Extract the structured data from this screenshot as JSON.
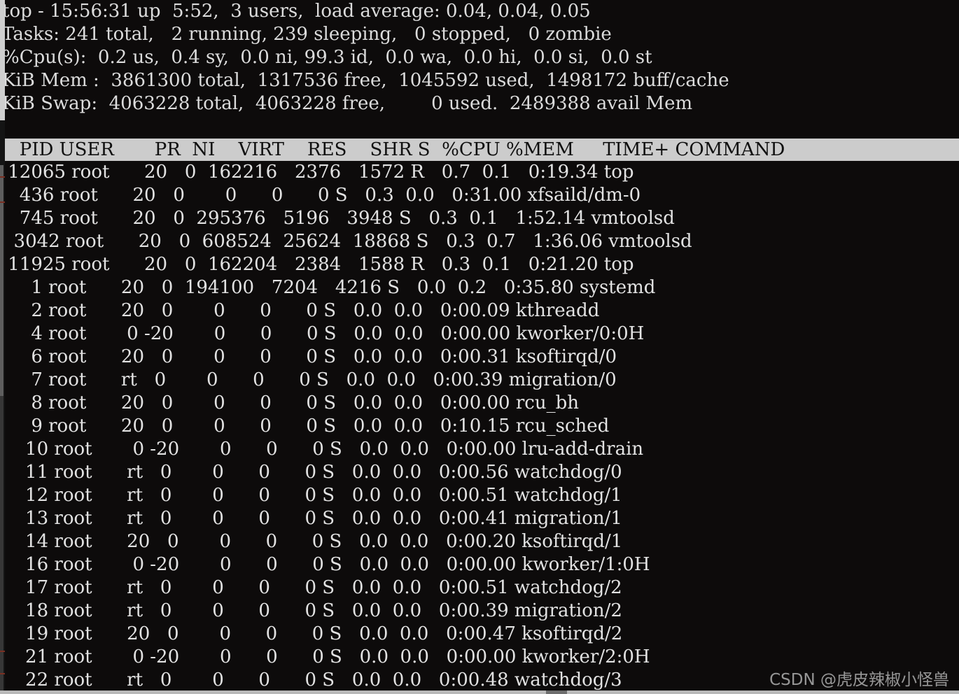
{
  "app": {
    "name": "top",
    "type": "terminal-process-monitor"
  },
  "summary": {
    "uptime_line": "top - 15:56:31 up  5:52,  3 users,  load average: 0.04, 0.04, 0.05",
    "tasks_line": "Tasks: 241 total,   2 running, 239 sleeping,   0 stopped,   0 zombie",
    "cpu_line": "%Cpu(s):  0.2 us,  0.4 sy,  0.0 ni, 99.3 id,  0.0 wa,  0.0 hi,  0.0 si,  0.0 st",
    "mem_line": "KiB Mem :  3861300 total,  1317536 free,  1045592 used,  1498172 buff/cache",
    "swap_line": "KiB Swap:  4063228 total,  4063228 free,        0 used.  2489388 avail Mem",
    "fields": {
      "time": "15:56:31",
      "up": "5:52",
      "users": "3",
      "load_avg_1": "0.04",
      "load_avg_5": "0.04",
      "load_avg_15": "0.05",
      "tasks_total": "241",
      "tasks_running": "2",
      "tasks_sleeping": "239",
      "tasks_stopped": "0",
      "tasks_zombie": "0",
      "cpu_us": "0.2",
      "cpu_sy": "0.4",
      "cpu_ni": "0.0",
      "cpu_id": "99.3",
      "cpu_wa": "0.0",
      "cpu_hi": "0.0",
      "cpu_si": "0.0",
      "cpu_st": "0.0",
      "mem_total": "3861300",
      "mem_free": "1317536",
      "mem_used": "1045592",
      "mem_buff_cache": "1498172",
      "swap_total": "4063228",
      "swap_free": "4063228",
      "swap_used": "0",
      "avail_mem": "2489388"
    }
  },
  "table": {
    "header_line": "   PID USER       PR  NI    VIRT    RES    SHR S  %CPU %MEM     TIME+ COMMAND",
    "columns": [
      "PID",
      "USER",
      "PR",
      "NI",
      "VIRT",
      "RES",
      "SHR",
      "S",
      "%CPU",
      "%MEM",
      "TIME+",
      "COMMAND"
    ],
    "rows": [
      {
        "line": " 12065 root      20   0  162216   2376   1572 R   0.7  0.1   0:19.34 top",
        "pid": "12065",
        "user": "root",
        "pr": "20",
        "ni": "0",
        "virt": "162216",
        "res": "2376",
        "shr": "1572",
        "s": "R",
        "cpu": "0.7",
        "mem": "0.1",
        "time": "0:19.34",
        "command": "top"
      },
      {
        "line": "   436 root      20   0       0      0      0 S   0.3  0.0   0:31.00 xfsaild/dm-0",
        "pid": "436",
        "user": "root",
        "pr": "20",
        "ni": "0",
        "virt": "0",
        "res": "0",
        "shr": "0",
        "s": "S",
        "cpu": "0.3",
        "mem": "0.0",
        "time": "0:31.00",
        "command": "xfsaild/dm-0"
      },
      {
        "line": "   745 root      20   0  295376   5196   3948 S   0.3  0.1   1:52.14 vmtoolsd",
        "pid": "745",
        "user": "root",
        "pr": "20",
        "ni": "0",
        "virt": "295376",
        "res": "5196",
        "shr": "3948",
        "s": "S",
        "cpu": "0.3",
        "mem": "0.1",
        "time": "1:52.14",
        "command": "vmtoolsd"
      },
      {
        "line": "  3042 root      20   0  608524  25624  18868 S   0.3  0.7   1:36.06 vmtoolsd",
        "pid": "3042",
        "user": "root",
        "pr": "20",
        "ni": "0",
        "virt": "608524",
        "res": "25624",
        "shr": "18868",
        "s": "S",
        "cpu": "0.3",
        "mem": "0.7",
        "time": "1:36.06",
        "command": "vmtoolsd"
      },
      {
        "line": " 11925 root      20   0  162204   2384   1588 R   0.3  0.1   0:21.20 top",
        "pid": "11925",
        "user": "root",
        "pr": "20",
        "ni": "0",
        "virt": "162204",
        "res": "2384",
        "shr": "1588",
        "s": "R",
        "cpu": "0.3",
        "mem": "0.1",
        "time": "0:21.20",
        "command": "top"
      },
      {
        "line": "     1 root      20   0  194100   7204   4216 S   0.0  0.2   0:35.80 systemd",
        "pid": "1",
        "user": "root",
        "pr": "20",
        "ni": "0",
        "virt": "194100",
        "res": "7204",
        "shr": "4216",
        "s": "S",
        "cpu": "0.0",
        "mem": "0.2",
        "time": "0:35.80",
        "command": "systemd"
      },
      {
        "line": "     2 root      20   0       0      0      0 S   0.0  0.0   0:00.09 kthreadd",
        "pid": "2",
        "user": "root",
        "pr": "20",
        "ni": "0",
        "virt": "0",
        "res": "0",
        "shr": "0",
        "s": "S",
        "cpu": "0.0",
        "mem": "0.0",
        "time": "0:00.09",
        "command": "kthreadd"
      },
      {
        "line": "     4 root       0 -20       0      0      0 S   0.0  0.0   0:00.00 kworker/0:0H",
        "pid": "4",
        "user": "root",
        "pr": "0",
        "ni": "-20",
        "virt": "0",
        "res": "0",
        "shr": "0",
        "s": "S",
        "cpu": "0.0",
        "mem": "0.0",
        "time": "0:00.00",
        "command": "kworker/0:0H"
      },
      {
        "line": "     6 root      20   0       0      0      0 S   0.0  0.0   0:00.31 ksoftirqd/0",
        "pid": "6",
        "user": "root",
        "pr": "20",
        "ni": "0",
        "virt": "0",
        "res": "0",
        "shr": "0",
        "s": "S",
        "cpu": "0.0",
        "mem": "0.0",
        "time": "0:00.31",
        "command": "ksoftirqd/0"
      },
      {
        "line": "     7 root      rt   0       0      0      0 S   0.0  0.0   0:00.39 migration/0",
        "pid": "7",
        "user": "root",
        "pr": "rt",
        "ni": "0",
        "virt": "0",
        "res": "0",
        "shr": "0",
        "s": "S",
        "cpu": "0.0",
        "mem": "0.0",
        "time": "0:00.39",
        "command": "migration/0"
      },
      {
        "line": "     8 root      20   0       0      0      0 S   0.0  0.0   0:00.00 rcu_bh",
        "pid": "8",
        "user": "root",
        "pr": "20",
        "ni": "0",
        "virt": "0",
        "res": "0",
        "shr": "0",
        "s": "S",
        "cpu": "0.0",
        "mem": "0.0",
        "time": "0:00.00",
        "command": "rcu_bh"
      },
      {
        "line": "     9 root      20   0       0      0      0 S   0.0  0.0   0:10.15 rcu_sched",
        "pid": "9",
        "user": "root",
        "pr": "20",
        "ni": "0",
        "virt": "0",
        "res": "0",
        "shr": "0",
        "s": "S",
        "cpu": "0.0",
        "mem": "0.0",
        "time": "0:10.15",
        "command": "rcu_sched"
      },
      {
        "line": "    10 root       0 -20       0      0      0 S   0.0  0.0   0:00.00 lru-add-drain",
        "pid": "10",
        "user": "root",
        "pr": "0",
        "ni": "-20",
        "virt": "0",
        "res": "0",
        "shr": "0",
        "s": "S",
        "cpu": "0.0",
        "mem": "0.0",
        "time": "0:00.00",
        "command": "lru-add-drain"
      },
      {
        "line": "    11 root      rt   0       0      0      0 S   0.0  0.0   0:00.56 watchdog/0",
        "pid": "11",
        "user": "root",
        "pr": "rt",
        "ni": "0",
        "virt": "0",
        "res": "0",
        "shr": "0",
        "s": "S",
        "cpu": "0.0",
        "mem": "0.0",
        "time": "0:00.56",
        "command": "watchdog/0"
      },
      {
        "line": "    12 root      rt   0       0      0      0 S   0.0  0.0   0:00.51 watchdog/1",
        "pid": "12",
        "user": "root",
        "pr": "rt",
        "ni": "0",
        "virt": "0",
        "res": "0",
        "shr": "0",
        "s": "S",
        "cpu": "0.0",
        "mem": "0.0",
        "time": "0:00.51",
        "command": "watchdog/1"
      },
      {
        "line": "    13 root      rt   0       0      0      0 S   0.0  0.0   0:00.41 migration/1",
        "pid": "13",
        "user": "root",
        "pr": "rt",
        "ni": "0",
        "virt": "0",
        "res": "0",
        "shr": "0",
        "s": "S",
        "cpu": "0.0",
        "mem": "0.0",
        "time": "0:00.41",
        "command": "migration/1"
      },
      {
        "line": "    14 root      20   0       0      0      0 S   0.0  0.0   0:00.20 ksoftirqd/1",
        "pid": "14",
        "user": "root",
        "pr": "20",
        "ni": "0",
        "virt": "0",
        "res": "0",
        "shr": "0",
        "s": "S",
        "cpu": "0.0",
        "mem": "0.0",
        "time": "0:00.20",
        "command": "ksoftirqd/1"
      },
      {
        "line": "    16 root       0 -20       0      0      0 S   0.0  0.0   0:00.00 kworker/1:0H",
        "pid": "16",
        "user": "root",
        "pr": "0",
        "ni": "-20",
        "virt": "0",
        "res": "0",
        "shr": "0",
        "s": "S",
        "cpu": "0.0",
        "mem": "0.0",
        "time": "0:00.00",
        "command": "kworker/1:0H"
      },
      {
        "line": "    17 root      rt   0       0      0      0 S   0.0  0.0   0:00.51 watchdog/2",
        "pid": "17",
        "user": "root",
        "pr": "rt",
        "ni": "0",
        "virt": "0",
        "res": "0",
        "shr": "0",
        "s": "S",
        "cpu": "0.0",
        "mem": "0.0",
        "time": "0:00.51",
        "command": "watchdog/2"
      },
      {
        "line": "    18 root      rt   0       0      0      0 S   0.0  0.0   0:00.39 migration/2",
        "pid": "18",
        "user": "root",
        "pr": "rt",
        "ni": "0",
        "virt": "0",
        "res": "0",
        "shr": "0",
        "s": "S",
        "cpu": "0.0",
        "mem": "0.0",
        "time": "0:00.39",
        "command": "migration/2"
      },
      {
        "line": "    19 root      20   0       0      0      0 S   0.0  0.0   0:00.47 ksoftirqd/2",
        "pid": "19",
        "user": "root",
        "pr": "20",
        "ni": "0",
        "virt": "0",
        "res": "0",
        "shr": "0",
        "s": "S",
        "cpu": "0.0",
        "mem": "0.0",
        "time": "0:00.47",
        "command": "ksoftirqd/2"
      },
      {
        "line": "    21 root       0 -20       0      0      0 S   0.0  0.0   0:00.00 kworker/2:0H",
        "pid": "21",
        "user": "root",
        "pr": "0",
        "ni": "-20",
        "virt": "0",
        "res": "0",
        "shr": "0",
        "s": "S",
        "cpu": "0.0",
        "mem": "0.0",
        "time": "0:00.00",
        "command": "kworker/2:0H"
      },
      {
        "line": "    22 root      rt   0       0      0      0 S   0.0  0.0   0:00.48 watchdog/3",
        "pid": "22",
        "user": "root",
        "pr": "rt",
        "ni": "0",
        "virt": "0",
        "res": "0",
        "shr": "0",
        "s": "S",
        "cpu": "0.0",
        "mem": "0.0",
        "time": "0:00.48",
        "command": "watchdog/3"
      }
    ]
  },
  "watermark": {
    "text": "CSDN @虎皮辣椒小怪兽"
  },
  "colors": {
    "background": "#0d0b0b",
    "text": "#e2e2e2",
    "header_bar_bg": "#cccccc",
    "header_bar_text": "#101010"
  }
}
